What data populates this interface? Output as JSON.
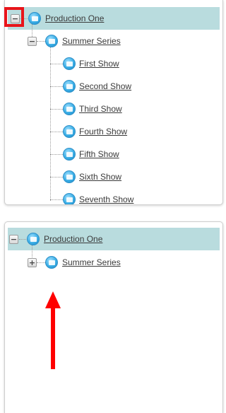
{
  "top_tree": {
    "root": {
      "label": "Production One",
      "toggle": "−",
      "icon": "folder-icon"
    },
    "series": {
      "label": "Summer Series",
      "toggle": "−",
      "icon": "folder-icon"
    },
    "shows": [
      {
        "label": "First Show"
      },
      {
        "label": "Second Show"
      },
      {
        "label": "Third Show"
      },
      {
        "label": "Fourth Show"
      },
      {
        "label": "Fifth Show"
      },
      {
        "label": "Sixth Show"
      },
      {
        "label": "Seventh Show"
      }
    ]
  },
  "bottom_tree": {
    "root": {
      "label": "Production One",
      "toggle": "−",
      "icon": "folder-icon"
    },
    "series": {
      "label": "Summer Series",
      "toggle": "+",
      "icon": "folder-icon"
    }
  },
  "annotations": {
    "highlight_color": "#e8141a",
    "arrow_color": "#ff0000"
  }
}
